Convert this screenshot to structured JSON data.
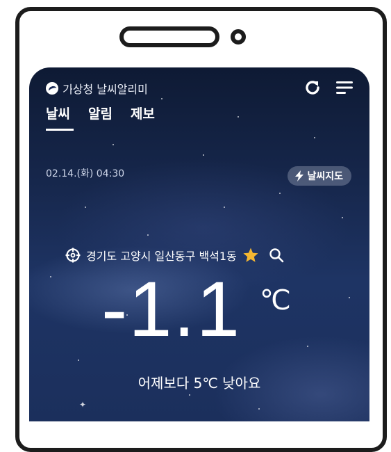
{
  "app": {
    "name": "기상청 날씨알리미"
  },
  "tabs": [
    {
      "label": "날씨",
      "active": true
    },
    {
      "label": "알림",
      "active": false
    },
    {
      "label": "제보",
      "active": false
    }
  ],
  "header_icons": [
    "refresh-icon",
    "menu-icon"
  ],
  "observation": {
    "datetime": "02.14.(화) 04:30"
  },
  "map_button": {
    "label": "날씨지도",
    "icon": "lightning-icon"
  },
  "location": {
    "name": "경기도 고양시 일산동구 백석1동",
    "locate_icon": "crosshair-icon",
    "favorite_icon": "star-icon",
    "search_icon": "search-icon"
  },
  "current": {
    "temperature": "-1.1",
    "unit": "℃",
    "comparison": "어제보다 5℃ 낮아요"
  },
  "colors": {
    "sky_top": "#0e1a34",
    "sky_bottom": "#1e3464",
    "star_accent": "#f5b731",
    "device_frame": "#1c1c1c"
  }
}
